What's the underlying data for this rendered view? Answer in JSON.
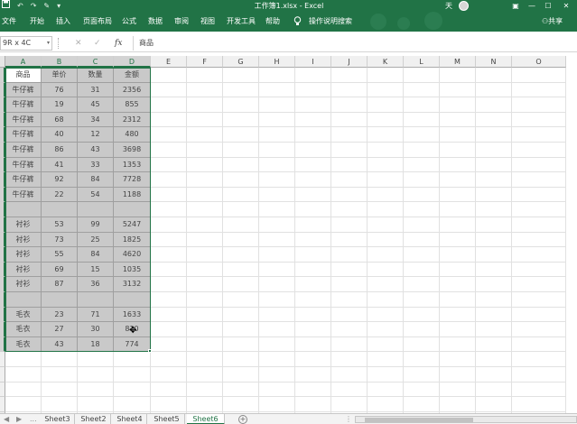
{
  "app": {
    "title": "工作簿1.xlsx  -  Excel",
    "user": "天",
    "share": "共享",
    "brand_color": "#217346"
  },
  "quick_access": {
    "save_icon": "save-icon",
    "undo_icon": "undo-icon",
    "redo_icon": "redo-icon",
    "brush_icon": "format-painter-icon"
  },
  "window_buttons": [
    "minimize-icon",
    "restore-icon",
    "close-icon"
  ],
  "ribbon_tabs": [
    "文件",
    "开始",
    "插入",
    "页面布局",
    "公式",
    "数据",
    "审阅",
    "视图",
    "开发工具",
    "帮助",
    "操作说明搜索"
  ],
  "formula_bar": {
    "name_box": "9R x 4C",
    "fx": "fx",
    "content": "商品"
  },
  "columns": [
    "A",
    "B",
    "C",
    "D",
    "E",
    "F",
    "G",
    "H",
    "I",
    "J",
    "K",
    "L",
    "M",
    "N",
    "O"
  ],
  "table": {
    "headers": [
      "商品",
      "单价",
      "数量",
      "金额"
    ],
    "rows": [
      [
        "牛仔裤",
        "76",
        "31",
        "2356"
      ],
      [
        "牛仔裤",
        "19",
        "45",
        "855"
      ],
      [
        "牛仔裤",
        "68",
        "34",
        "2312"
      ],
      [
        "牛仔裤",
        "40",
        "12",
        "480"
      ],
      [
        "牛仔裤",
        "86",
        "43",
        "3698"
      ],
      [
        "牛仔裤",
        "41",
        "33",
        "1353"
      ],
      [
        "牛仔裤",
        "92",
        "84",
        "7728"
      ],
      [
        "牛仔裤",
        "22",
        "54",
        "1188"
      ],
      [
        "",
        "",
        "",
        ""
      ],
      [
        "衬衫",
        "53",
        "99",
        "5247"
      ],
      [
        "衬衫",
        "73",
        "25",
        "1825"
      ],
      [
        "衬衫",
        "55",
        "84",
        "4620"
      ],
      [
        "衬衫",
        "69",
        "15",
        "1035"
      ],
      [
        "衬衫",
        "87",
        "36",
        "3132"
      ],
      [
        "",
        "",
        "",
        ""
      ],
      [
        "毛衣",
        "23",
        "71",
        "1633"
      ],
      [
        "毛衣",
        "27",
        "30",
        "810"
      ],
      [
        "毛衣",
        "43",
        "18",
        "774"
      ]
    ]
  },
  "sheets": {
    "nav_more": "...",
    "tabs": [
      "Sheet3",
      "Sheet2",
      "Sheet4",
      "Sheet5",
      "Sheet6"
    ],
    "active": "Sheet6",
    "add": "+"
  }
}
